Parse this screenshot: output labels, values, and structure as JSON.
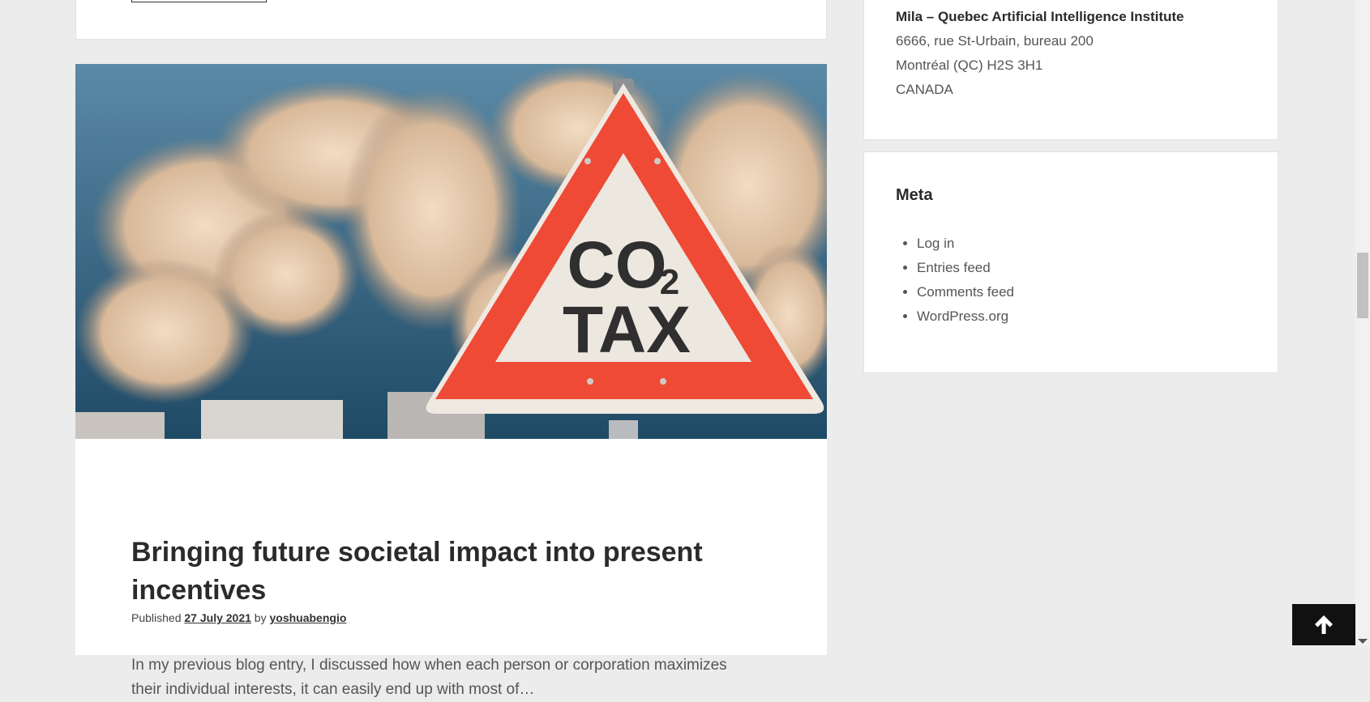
{
  "address": {
    "name": "Mila – Quebec Artificial Intelligence Institute",
    "lines": [
      "6666, rue St-Urbain, bureau 200",
      "Montréal (QC) H2S 3H1",
      "CANADA"
    ]
  },
  "meta_widget": {
    "title": "Meta",
    "links": [
      "Log in",
      "Entries feed",
      "Comments feed",
      "WordPress.org"
    ]
  },
  "post": {
    "image_sign": {
      "top_main": "CO",
      "top_sub": "2",
      "bottom": "TAX"
    },
    "title": "Bringing future societal impact into present incentives",
    "published_label": "Published",
    "date": "27 July 2021",
    "by_label": "by",
    "author": "yoshuabengio",
    "excerpt": "In my previous blog entry, I discussed how when each person or corporation maximizes their individual interests, it can easily end up with most of…"
  },
  "colors": {
    "sign_red": "#ee4a35",
    "sign_white": "#ece7df",
    "sky": "#4d7f9c",
    "smoke": "#e8cdb0"
  },
  "icons": {
    "scroll_top": "arrow-up-icon"
  }
}
